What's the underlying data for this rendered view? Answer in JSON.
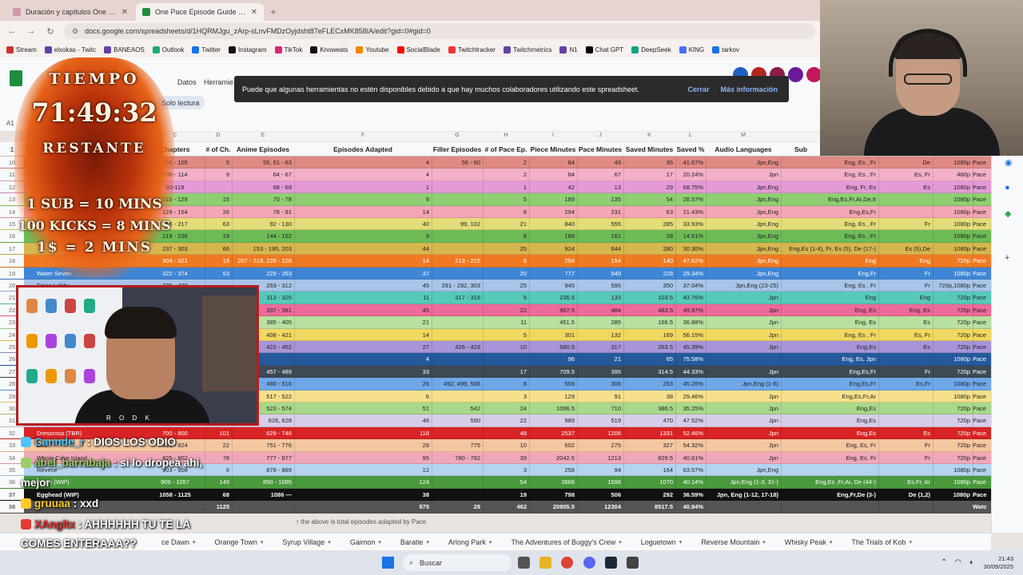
{
  "browser": {
    "tabs": [
      {
        "title": "Duración y capítulos One Piece",
        "active": false
      },
      {
        "title": "One Pace Episode Guide - Hoja",
        "active": true
      }
    ],
    "url": "docs.google.com/spreadsheets/d/1HQRMJgu_zArp-sLnvFMDzOyjdsht87eFLECxMK858IA/edit?gid=0#gid=0",
    "bookmarks": [
      "Stream",
      "elxokas - Twitc",
      "BANEAOS",
      "Outlook",
      "Twitter",
      "Instagram",
      "TikTok",
      "Knoweats",
      "Youtube",
      "SocialBlade",
      "Twitchtracker",
      "Twitchmetrics",
      "N1",
      "Chat GPT",
      "DeepSeek",
      "KING",
      "tarkov"
    ]
  },
  "sheets": {
    "menu": {
      "datos": "Datos",
      "herramientas": "Herramie"
    },
    "readonly_badge": "Solo lectura",
    "cell_ref": "A1",
    "toast": {
      "message": "Puede que algunas herramientas no estén disponibles debido a que hay muchos colaboradores utilizando este spreadsheet.",
      "close": "Cerrar",
      "more": "Más información"
    },
    "col_letters": [
      "C",
      "D",
      "E",
      "F",
      "G",
      "H",
      "I",
      "J",
      "K",
      "L",
      "M"
    ],
    "headers": [
      "Chapters",
      "# of Ch.",
      "Anime Episodes",
      "Episodes Adapted",
      "Filler Episodes",
      "# of Pace Ep.",
      "Piece Minutes",
      "Pace Minutes",
      "Saved Minutes",
      "Saved %",
      "Audio Languages",
      "Sub"
    ],
    "header_row_num": "1",
    "rows": [
      {
        "n": "10",
        "name": "Revers",
        "ch": "101 - 105",
        "nch": "5",
        "ep": "55, 61 - 63",
        "ad": "4",
        "fill": "56 - 60",
        "pace": "2",
        "pm": "84",
        "pa": "49",
        "sm": "35",
        "sp": "41.67%",
        "au": "Jpn,Eng",
        "sub": "Eng, Es , Fr",
        "s2": "De",
        "res": "1080p",
        "p": "Pace",
        "bg": "#e08a84"
      },
      {
        "n": "11",
        "name": "Whisky Peak (TBR)",
        "ch": "106 - 114",
        "nch": "9",
        "ep": "64 - 67",
        "ad": "4",
        "fill": "",
        "pace": "2",
        "pm": "84",
        "pa": "67",
        "sm": "17",
        "sp": "20.24%",
        "au": "Jpn",
        "sub": "Eng, Es , Fr",
        "s2": "Es, Fr",
        "res": "480p",
        "p": "Pace",
        "bg": "#f4b0c8"
      },
      {
        "n": "12",
        "name": "",
        "ch": "83-119",
        "nch": "",
        "ep": "68 - 69",
        "ad": "1",
        "fill": "",
        "pace": "1",
        "pm": "42",
        "pa": "13",
        "sm": "29",
        "sp": "68.75%",
        "au": "Jpn,Eng",
        "sub": "Eng, Fr, Es",
        "s2": "Es",
        "res": "1080p",
        "p": "Pace",
        "bg": "#e59ad6"
      },
      {
        "n": "13",
        "name": "",
        "ch": "115 - 129",
        "nch": "15",
        "ep": "70 - 78",
        "ad": "9",
        "fill": "",
        "pace": "5",
        "pm": "189",
        "pa": "135",
        "sm": "54",
        "sp": "28.57%",
        "au": "Jpn,Eng",
        "sub": "Eng,Es,Fr,Ar,De,It",
        "s2": "",
        "res": "1080p",
        "p": "Pace",
        "bg": "#8fcf72"
      },
      {
        "n": "14",
        "name": "",
        "ch": "129 - 154",
        "nch": "26",
        "ep": "78 - 91",
        "ad": "14",
        "fill": "",
        "pace": "8",
        "pm": "294",
        "pa": "231",
        "sm": "63",
        "sp": "21.43%",
        "au": "Jpn,Eng",
        "sub": "Eng,Es,Fr",
        "s2": "",
        "res": "1080p",
        "p": "Pace",
        "bg": "#f4a6b6"
      },
      {
        "n": "15",
        "name": "",
        "ch": "155 - 217",
        "nch": "63",
        "ep": "92 - 130",
        "ad": "40",
        "fill": "99, 102",
        "pace": "21",
        "pm": "840",
        "pa": "555",
        "sm": "285",
        "sp": "33.93%",
        "au": "Jpn,Eng",
        "sub": "Eng, Es , Fr",
        "s2": "Fr",
        "res": "1080p",
        "p": "Pace",
        "bg": "#e4dc78"
      },
      {
        "n": "16",
        "name": "",
        "ch": "218 - 236",
        "nch": "19",
        "ep": "144 - 152",
        "ad": "9",
        "fill": "",
        "pace": "8",
        "pm": "189",
        "pa": "161",
        "sm": "28",
        "sp": "14.81%",
        "au": "Jpn,Eng",
        "sub": "Eng, Es , Fr",
        "s2": "",
        "res": "1080p",
        "p": "Pace",
        "bg": "#6dbb56"
      },
      {
        "n": "17",
        "name": "",
        "ch": "237 - 303",
        "nch": "66",
        "ep": "153 - 195, 203",
        "ad": "44",
        "fill": "",
        "pace": "25",
        "pm": "924",
        "pa": "644",
        "sm": "280",
        "sp": "30.30%",
        "au": "Jpn,Eng",
        "sub": "Eng,Es (1-4), Fr, Es (5), De (17-)",
        "s2": "Es (5),De",
        "res": "1080p",
        "p": "Pace",
        "bg": "#d8b64e"
      },
      {
        "n": "18",
        "name": "",
        "ch": "304 - 321",
        "nch": "19",
        "ep": "207 - 219, 226 - 228",
        "ad": "14",
        "fill": "213 - 215",
        "pace": "6",
        "pm": "294",
        "pa": "154",
        "sm": "140",
        "sp": "47.62%",
        "au": "Jpn,Eng",
        "sub": "Eng",
        "s2": "Eng",
        "res": "720p",
        "p": "Pace",
        "bg": "#f07a24"
      },
      {
        "n": "19",
        "name": "Water Seven",
        "ch": "322 - 374",
        "nch": "53",
        "ep": "229 - 263",
        "ad": "37",
        "fill": "",
        "pace": "20",
        "pm": "777",
        "pa": "549",
        "sm": "228",
        "sp": "29.34%",
        "au": "Jpn,Eng",
        "sub": "Eng,Fr",
        "s2": "Fr",
        "res": "1080p",
        "p": "Pace",
        "bg": "#3f86d6"
      },
      {
        "n": "20",
        "name": "Enies Lobby",
        "ch": "375 - 430",
        "nch": "",
        "ep": "263 - 312",
        "ad": "45",
        "fill": "291 - 292, 303",
        "pace": "25",
        "pm": "945",
        "pa": "595",
        "sm": "350",
        "sp": "37.04%",
        "au": "Jpn,Eng (23-25)",
        "sub": "Eng, Es , Fr",
        "s2": "Fr",
        "res": "720p,1080p",
        "p": "Pace",
        "bg": "#a8c4e8"
      },
      {
        "n": "21",
        "name": "",
        "ch": "",
        "nch": "",
        "ep": "313 - 325",
        "ad": "11",
        "fill": "317 - 318",
        "pace": "5",
        "pm": "236.5",
        "pa": "133",
        "sm": "103.5",
        "sp": "43.76%",
        "au": "Jpn",
        "sub": "Eng",
        "s2": "Eng",
        "res": "720p",
        "p": "Pace",
        "bg": "#57c9b8"
      },
      {
        "n": "22",
        "name": "",
        "ch": "",
        "nch": "",
        "ep": "337 - 381",
        "ad": "45",
        "fill": "",
        "pace": "22",
        "pm": "967.5",
        "pa": "484",
        "sm": "483.5",
        "sp": "49.97%",
        "au": "Jpn",
        "sub": "Eng, Es",
        "s2": "Eng, Es",
        "res": "720p",
        "p": "Pace",
        "bg": "#ee6a9a"
      },
      {
        "n": "23",
        "name": "",
        "ch": "",
        "nch": "",
        "ep": "385 - 405",
        "ad": "21",
        "fill": "",
        "pace": "11",
        "pm": "451.5",
        "pa": "285",
        "sm": "166.5",
        "sp": "36.88%",
        "au": "Jpn",
        "sub": "Eng, Es",
        "s2": "Es",
        "res": "720p",
        "p": "Pace",
        "bg": "#b8e0a0"
      },
      {
        "n": "24",
        "name": "",
        "ch": "",
        "nch": "",
        "ep": "408 - 421",
        "ad": "14",
        "fill": "",
        "pace": "5",
        "pm": "301",
        "pa": "132",
        "sm": "169",
        "sp": "56.15%",
        "au": "Jpn",
        "sub": "Eng, Es , Fr",
        "s2": "Es, Fr",
        "res": "720p",
        "p": "Pace",
        "bg": "#f0d860"
      },
      {
        "n": "25",
        "name": "",
        "ch": "",
        "nch": "",
        "ep": "422 - 452",
        "ad": "27",
        "fill": "426 - 429",
        "pace": "10",
        "pm": "580.5",
        "pa": "317",
        "sm": "263.5",
        "sp": "45.39%",
        "au": "Jpn",
        "sub": "Eng,Es",
        "s2": "Es",
        "res": "720p",
        "p": "Pace",
        "bg": "#a894d8"
      },
      {
        "n": "26",
        "name": "",
        "ch": "",
        "nch": "",
        "ep": "",
        "ad": "4",
        "fill": "",
        "pace": "",
        "pm": "96",
        "pa": "21",
        "sm": "65",
        "sp": "75.58%",
        "au": "",
        "sub": "Eng, Es, Jpn",
        "s2": "",
        "res": "1080p",
        "p": "Pace",
        "bg": "#245a9c"
      },
      {
        "n": "27",
        "name": "",
        "ch": "",
        "nch": "",
        "ep": "457 - 489",
        "ad": "33",
        "fill": "",
        "pace": "17",
        "pm": "709.5",
        "pa": "395",
        "sm": "314.5",
        "sp": "44.33%",
        "au": "Jpn",
        "sub": "Eng,Es,Fr",
        "s2": "Fr",
        "res": "720p",
        "p": "Pace",
        "bg": "#3d4a56"
      },
      {
        "n": "28",
        "name": "",
        "ch": "",
        "nch": "",
        "ep": "490 - 516",
        "ad": "26",
        "fill": "492, 499, 506",
        "pace": "8",
        "pm": "559",
        "pa": "306",
        "sm": "253",
        "sp": "45.26%",
        "au": "Jpn,Eng (1-6)",
        "sub": "Eng,Es,Fr",
        "s2": "Es,Fr",
        "res": "1080p",
        "p": "Pace",
        "bg": "#6fa8e8"
      },
      {
        "n": "29",
        "name": "",
        "ch": "",
        "nch": "",
        "ep": "517 - 522",
        "ad": "6",
        "fill": "",
        "pace": "3",
        "pm": "129",
        "pa": "91",
        "sm": "38",
        "sp": "29.46%",
        "au": "Jpn",
        "sub": "Eng,Es,Fr,Ar",
        "s2": "",
        "res": "1080p",
        "p": "Pace",
        "bg": "#f6e08a"
      },
      {
        "n": "30",
        "name": "",
        "ch": "",
        "nch": "",
        "ep": "523 - 574",
        "ad": "51",
        "fill": "542",
        "pace": "24",
        "pm": "1096.5",
        "pa": "710",
        "sm": "386.5",
        "sp": "35.25%",
        "au": "Jpn",
        "sub": "Eng,Es",
        "s2": "",
        "res": "720p",
        "p": "Pace",
        "bg": "#a8d88a"
      },
      {
        "n": "31",
        "name": "",
        "ch": "",
        "nch": "",
        "ep": "626, 628",
        "ad": "46",
        "fill": "590",
        "pace": "22",
        "pm": "989",
        "pa": "519",
        "sm": "470",
        "sp": "47.52%",
        "au": "Jpn",
        "sub": "Eng,Es",
        "s2": "",
        "res": "720p",
        "p": "Pace",
        "bg": "#d8cce8"
      },
      {
        "n": "32",
        "name": "Dressrosa (TBR)",
        "ch": "700 - 800",
        "nch": "101",
        "ep": "629 - 746",
        "ad": "118",
        "fill": "",
        "pace": "48",
        "pm": "2537",
        "pa": "1206",
        "sm": "1331",
        "sp": "52.46%",
        "au": "Jpn",
        "sub": "Eng,Es",
        "s2": "Es",
        "res": "720p",
        "p": "Pace",
        "bg": "#d82424"
      },
      {
        "n": "33",
        "name": "Zou",
        "ch": "802 - 824",
        "nch": "22",
        "ep": "751 - 776",
        "ad": "28",
        "fill": "775",
        "pace": "10",
        "pm": "602",
        "pa": "275",
        "sm": "327",
        "sp": "54.32%",
        "au": "Jpn",
        "sub": "Eng, Es, Fr",
        "s2": "Fr",
        "res": "720p",
        "p": "Pace",
        "bg": "#f4c6a0"
      },
      {
        "n": "34",
        "name": "Whole Cake Island",
        "ch": "825 - 902",
        "nch": "78",
        "ep": "777 - 877",
        "ad": "95",
        "fill": "780 - 782",
        "pace": "39",
        "pm": "2042.5",
        "pa": "1213",
        "sm": "829.5",
        "sp": "40.61%",
        "au": "Jpn",
        "sub": "Eng, Es, Fr",
        "s2": "Fr",
        "res": "720p",
        "p": "Pace",
        "bg": "#f0a8b8"
      },
      {
        "n": "35",
        "name": "Reverie",
        "ch": "903 - 908",
        "nch": "6",
        "ep": "878 - 889",
        "ad": "12",
        "fill": "",
        "pace": "3",
        "pm": "258",
        "pa": "94",
        "sm": "164",
        "sp": "63.57%",
        "au": "Jpn,Eng",
        "sub": "",
        "s2": "",
        "res": "1080p",
        "p": "Pace",
        "bg": "#b4d4f0"
      },
      {
        "n": "36",
        "name": "Wano (WIP)",
        "ch": "909 - 1057",
        "nch": "149",
        "ep": "890 - 1085",
        "ad": "124",
        "fill": "",
        "pace": "54",
        "pm": "2666",
        "pa": "1596",
        "sm": "1070",
        "sp": "40.14%",
        "au": "Jpn,Eng (1-3, 31-)",
        "sub": "Eng,Es ,Fr,Ar, De (44-)",
        "s2": "Es,Fr, Ar",
        "res": "1080p",
        "p": "Pace",
        "bg": "#4a9a3c"
      },
      {
        "n": "37",
        "name": "Egghead (WIP)",
        "ch": "1058 - 1125",
        "nch": "68",
        "ep": "1086 —",
        "ad": "38",
        "fill": "",
        "pace": "19",
        "pm": "798",
        "pa": "506",
        "sm": "292",
        "sp": "36.59%",
        "au": "Jpn, Eng (1-12, 17-18)",
        "sub": "Eng,Fr,De (3-)",
        "s2": "De (1,2)",
        "res": "1080p",
        "p": "Pace",
        "bg": "#111111"
      },
      {
        "n": "38",
        "name": "",
        "ch": "",
        "nch": "1125",
        "ep": "",
        "ad": "975",
        "fill": "28",
        "pace": "462",
        "pm": "20805.5",
        "pa": "12304",
        "sm": "8517.5",
        "sp": "40.94%",
        "au": "",
        "sub": "",
        "s2": "",
        "res": "",
        "p": "Watc",
        "bg": "#555555"
      }
    ],
    "footer_note": "↑ the above is total episodes adapted by Pace",
    "sheet_tabs": [
      "ce Dawn",
      "Orange Town",
      "Syrup Village",
      "Gaimon",
      "Baratie",
      "Arlong Park",
      "The Adventures of Buggy's Crew",
      "Loguetown",
      "Reverse Mountain",
      "Whisky Peak",
      "The Trials of Kob"
    ]
  },
  "overlay": {
    "timer_title": "TIEMPO",
    "timer_value": "71:49:32",
    "timer_label": "RESTANTE",
    "rules": [
      "1 SUB = 10 MINS",
      "100 KICKS = 8 MINS",
      "1$ = 2 MINS"
    ],
    "cam_tag": "R O D K",
    "chat": [
      {
        "user": "Cannde_r",
        "text": " : DIOS LOS ODIO",
        "color": "#4fc3f7"
      },
      {
        "user": "abel_barrabaja",
        "text": " : si lo dropea ahi,",
        "color": "#9ccc65"
      },
      {
        "user": "",
        "text": "mejor",
        "color": "#ffffff"
      },
      {
        "user": "gruuaa",
        "text": " : xxd",
        "color": "#ffca28"
      },
      {
        "user": "XAngltx",
        "text": " : AHHHHHH TU TE LA",
        "color": "#e53935"
      },
      {
        "user": "",
        "text": "COMES ENTERAAA??",
        "color": "#ffffff"
      }
    ]
  },
  "taskbar": {
    "search": "Buscar",
    "time": "21:43",
    "date": "30/09/2025"
  }
}
